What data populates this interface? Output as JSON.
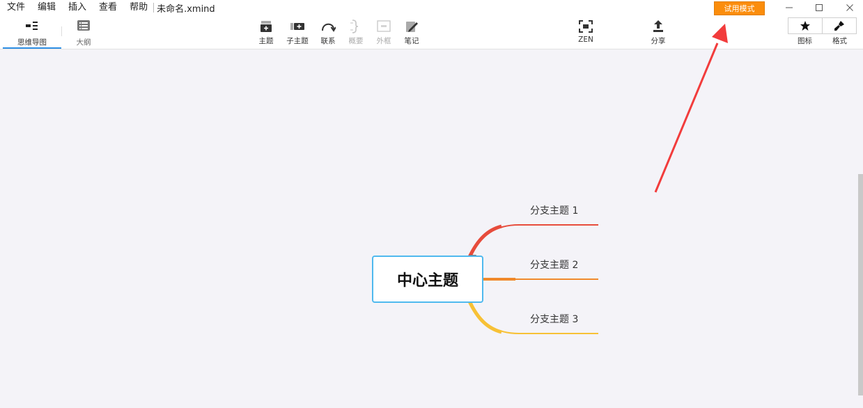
{
  "menu": {
    "items": [
      "文件",
      "编辑",
      "插入",
      "查看",
      "帮助"
    ],
    "file_title": "未命名.xmind"
  },
  "trial_badge": "试用模式",
  "window": {
    "minimize_icon": "minimize-icon",
    "maximize_icon": "maximize-icon",
    "close_icon": "close-icon"
  },
  "views": {
    "mindmap": "思维导图",
    "outline": "大纲"
  },
  "toolbar": {
    "topic": "主题",
    "subtopic": "子主题",
    "relationship": "联系",
    "summary": "概要",
    "boundary": "外框",
    "notes": "笔记",
    "zen": "ZEN",
    "share": "分享",
    "icons": "图标",
    "format": "格式"
  },
  "mindmap": {
    "central_topic": "中心主题",
    "branches": [
      {
        "label": "分支主题 1",
        "color": "#e74c3c"
      },
      {
        "label": "分支主题 2",
        "color": "#f0892b"
      },
      {
        "label": "分支主题 3",
        "color": "#f7c136"
      }
    ]
  },
  "annotation": {
    "arrow_color": "#f23c3c"
  },
  "colors": {
    "accent": "#2e8fe5",
    "trial": "#fb8d0c",
    "central_border": "#4fb9ee"
  }
}
